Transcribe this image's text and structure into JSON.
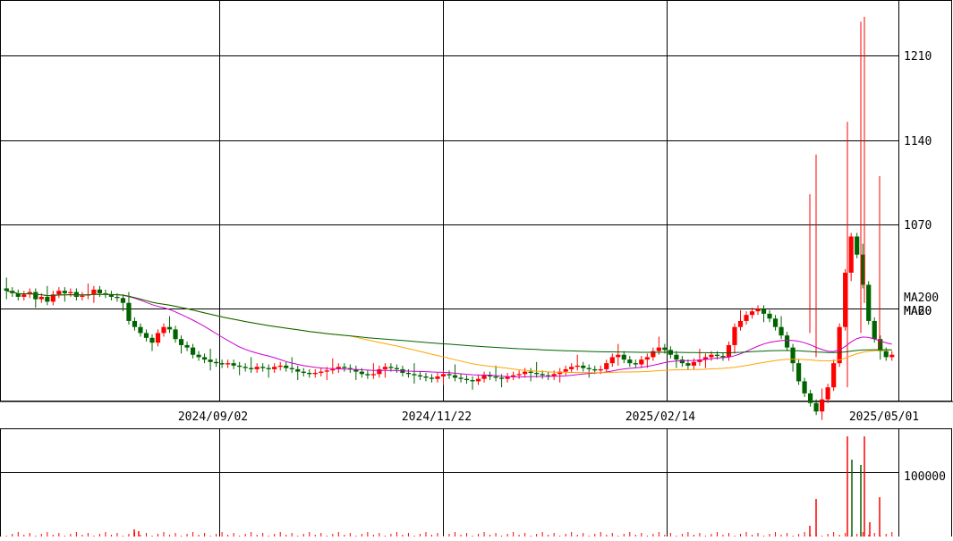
{
  "chart_data": {
    "type": "candlestick",
    "price_panel": {
      "y_ticks": [
        1070,
        1140,
        1210
      ],
      "y_tick_labels": [
        "1070",
        "1140",
        "1210"
      ],
      "ylim": [
        924,
        1256
      ],
      "x_tick_labels": [
        "2024/09/02",
        "2024/11/22",
        "2025/02/14",
        "2025/05/01"
      ],
      "grid": true,
      "legend": [
        "MA200",
        "MA20",
        "MA60"
      ],
      "colors": {
        "up": "#ff0000",
        "down": "#006400",
        "ma200": "#006400",
        "ma20": "#cc00cc",
        "ma60": "#ffa500"
      },
      "approx_closes": [
        1015,
        1013,
        1010,
        1012,
        1014,
        1008,
        1010,
        1006,
        1012,
        1015,
        1013,
        1014,
        1010,
        1011,
        1012,
        1016,
        1013,
        1012,
        1010,
        1009,
        1005,
        990,
        985,
        980,
        976,
        972,
        980,
        985,
        983,
        975,
        970,
        968,
        962,
        960,
        958,
        956,
        955,
        954,
        955,
        953,
        952,
        951,
        950,
        952,
        951,
        950,
        952,
        953,
        951,
        950,
        948,
        947,
        946,
        947,
        948,
        949,
        950,
        952,
        951,
        950,
        948,
        946,
        945,
        946,
        950,
        952,
        951,
        950,
        947,
        946,
        945,
        944,
        943,
        942,
        944,
        946,
        945,
        943,
        942,
        941,
        940,
        942,
        945,
        944,
        943,
        942,
        944,
        945,
        946,
        948,
        947,
        946,
        945,
        944,
        946,
        948,
        950,
        952,
        953,
        951,
        950,
        949,
        950,
        955,
        960,
        962,
        958,
        955,
        954,
        958,
        960,
        965,
        968,
        966,
        962,
        958,
        955,
        953,
        956,
        958,
        960,
        962,
        961,
        960,
        970,
        985,
        990,
        995,
        998,
        1000,
        996,
        992,
        985,
        978,
        968,
        955,
        940,
        930,
        922,
        915,
        925,
        935,
        955,
        985,
        1030,
        1060,
        1045,
        1020,
        990,
        975,
        965,
        960,
        962
      ]
    },
    "volume_panel": {
      "y_ticks": [
        100000
      ],
      "y_tick_labels": [
        "100000"
      ],
      "grid": true
    }
  }
}
